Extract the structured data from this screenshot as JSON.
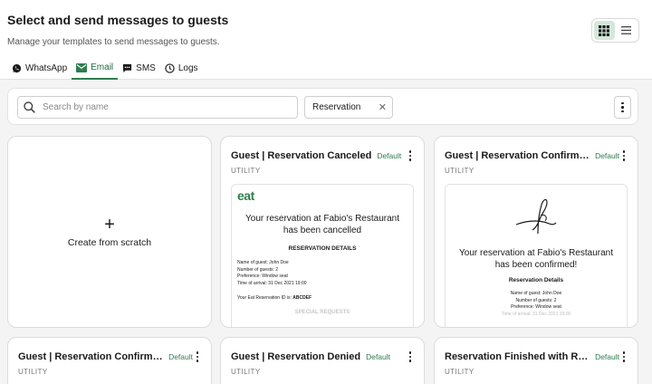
{
  "header": {
    "title": "Select and send messages to guests",
    "subtitle": "Manage your templates to send messages to guests."
  },
  "view_toggle": {
    "active": "grid"
  },
  "tabs": [
    {
      "label": "WhatsApp",
      "icon": "whatsapp-icon"
    },
    {
      "label": "Email",
      "icon": "mail-icon",
      "active": true
    },
    {
      "label": "SMS",
      "icon": "sms-icon"
    },
    {
      "label": "Logs",
      "icon": "clock-icon"
    }
  ],
  "filters": {
    "search_placeholder": "Search by name",
    "search_value": "",
    "chip_label": "Reservation",
    "chip_clear": "✕"
  },
  "create_card": {
    "label": "Create from scratch",
    "plus": "+"
  },
  "cards": [
    {
      "title": "Guest | Reservation Canceled",
      "badge": "Default",
      "category": "UTILITY",
      "preview": {
        "logo": "eat",
        "heading_line1": "Your reservation at Fabio's Restaurant",
        "heading_line2": "has been cancelled",
        "details_title": "RESERVATION DETAILS",
        "details": [
          "Name of guest: John Doe",
          "Number of guests: 2",
          "Preference: Window seat",
          "Time of arrival: 31 Dec 2021 19:00"
        ],
        "id_label": "Your Eat Reservation ID is: ",
        "id_value": "ABCDEF",
        "special": "SPECIAL REQUESTS"
      }
    },
    {
      "title": "Guest | Reservation Confirmed ...",
      "badge": "Default",
      "category": "UTILITY",
      "preview": {
        "heading_line1": "Your reservation at Fabio's Restaurant",
        "heading_line2": "has been confirmed!",
        "details_title": "Reservation Details",
        "details": [
          "Name of guest: John Doe",
          "Number of guests: 2",
          "Preference: Window seat",
          "Time of arrival: 31 Dec 2021 19:00"
        ]
      }
    },
    {
      "title": "Guest | Reservation Confirmed ...",
      "badge": "Default",
      "category": "UTILITY"
    },
    {
      "title": "Guest | Reservation Denied",
      "badge": "Default",
      "category": "UTILITY"
    },
    {
      "title": "Reservation Finished with Review",
      "badge": "Default",
      "category": "UTILITY"
    }
  ],
  "colors": {
    "accent": "#2e7d4f",
    "accent_bg": "#d3e8da"
  }
}
